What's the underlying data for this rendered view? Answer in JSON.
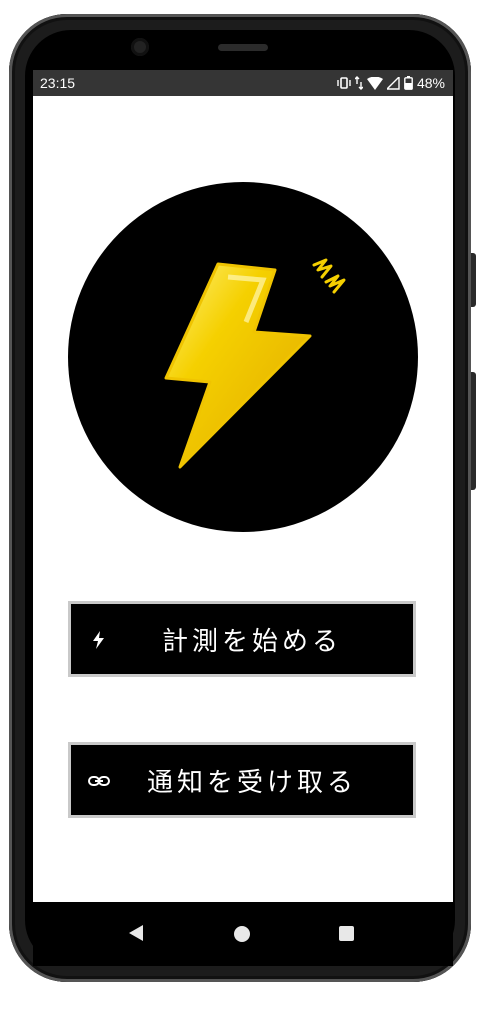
{
  "status_bar": {
    "time": "23:15",
    "battery_percent": "48%",
    "icons": [
      "vibrate-icon",
      "data-arrows-icon",
      "wifi-icon",
      "signal-icon",
      "battery-icon"
    ]
  },
  "logo": {
    "icon": "lightning-bolt-icon",
    "bolt_color": "#f5d000",
    "background_color": "#000000"
  },
  "buttons": {
    "measure": {
      "label": "計測を始める",
      "icon": "lightning-icon"
    },
    "notify": {
      "label": "通知を受け取る",
      "icon": "link-icon"
    }
  },
  "nav_bar": {
    "icons": [
      "back-icon",
      "home-icon",
      "recents-icon"
    ]
  }
}
